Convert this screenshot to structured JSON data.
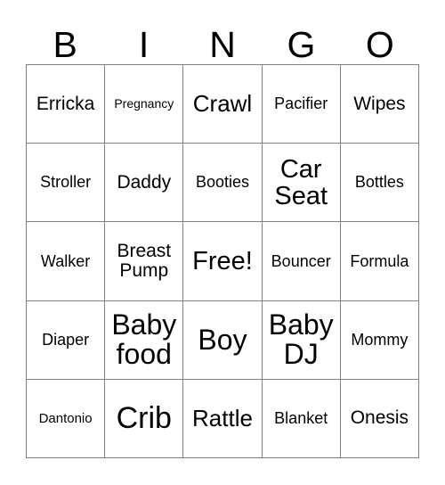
{
  "card": {
    "title": "BINGO",
    "header_letters": [
      "B",
      "I",
      "N",
      "G",
      "O"
    ],
    "border_color": "#808080",
    "text_color": "#000000",
    "background_color": "#ffffff",
    "columns": 5,
    "rows": 5,
    "cells": [
      {
        "text": "Erricka",
        "size": "ml",
        "lines": 1
      },
      {
        "text": "Pregnancy",
        "size": "xs",
        "lines": 1
      },
      {
        "text": "Crawl",
        "size": "l",
        "lines": 1
      },
      {
        "text": "Pacifier",
        "size": "m",
        "lines": 1
      },
      {
        "text": "Wipes",
        "size": "ml",
        "lines": 1
      },
      {
        "text": "Stroller",
        "size": "m",
        "lines": 1
      },
      {
        "text": "Daddy",
        "size": "ml",
        "lines": 1
      },
      {
        "text": "Booties",
        "size": "m",
        "lines": 1
      },
      {
        "text": "Car\nSeat",
        "size": "xl",
        "lines": 2
      },
      {
        "text": "Bottles",
        "size": "m",
        "lines": 1
      },
      {
        "text": "Walker",
        "size": "m",
        "lines": 1
      },
      {
        "text": "Breast\nPump",
        "size": "ml",
        "lines": 2
      },
      {
        "text": "Free!",
        "size": "xl",
        "lines": 1
      },
      {
        "text": "Bouncer",
        "size": "m",
        "lines": 1
      },
      {
        "text": "Formula",
        "size": "m",
        "lines": 1
      },
      {
        "text": "Diaper",
        "size": "m",
        "lines": 1
      },
      {
        "text": "Baby\nfood",
        "size": "xxl",
        "lines": 2
      },
      {
        "text": "Boy",
        "size": "xxl",
        "lines": 1
      },
      {
        "text": "Baby\nDJ",
        "size": "xxl",
        "lines": 2
      },
      {
        "text": "Mommy",
        "size": "m",
        "lines": 1
      },
      {
        "text": "Dantonio",
        "size": "s",
        "lines": 1
      },
      {
        "text": "Crib",
        "size": "h",
        "lines": 1
      },
      {
        "text": "Rattle",
        "size": "l",
        "lines": 1
      },
      {
        "text": "Blanket",
        "size": "m",
        "lines": 1
      },
      {
        "text": "Onesis",
        "size": "ml",
        "lines": 1
      }
    ]
  }
}
